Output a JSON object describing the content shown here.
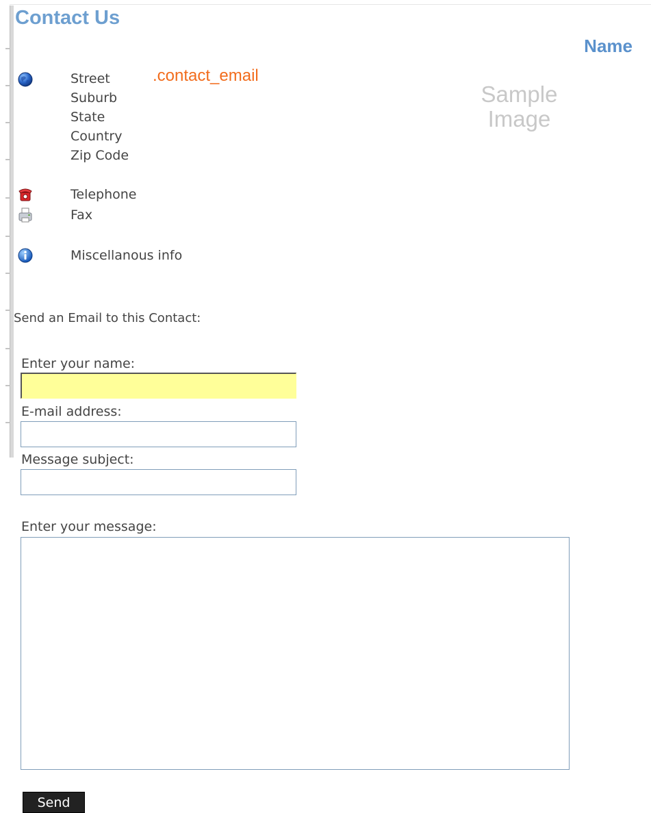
{
  "page": {
    "title": "Contact Us"
  },
  "contact": {
    "name": "Name",
    "email": ".contact_email",
    "image_text_line1": "Sample",
    "image_text_line2": "Image",
    "address": [
      "Street",
      "Suburb",
      "State",
      "Country",
      "Zip Code"
    ],
    "telephone": "Telephone",
    "fax": "Fax",
    "misc": "Miscellanous info"
  },
  "icons": {
    "address": "globe-icon",
    "telephone": "telephone-icon",
    "fax": "fax-icon",
    "misc": "info-icon"
  },
  "form": {
    "heading": "Send an Email to this Contact:",
    "name_label": "Enter your name:",
    "name_value": "",
    "email_label": "E-mail address:",
    "email_value": "",
    "subject_label": "Message subject:",
    "subject_value": "",
    "message_label": "Enter your message:",
    "message_value": "",
    "send_label": "Send"
  },
  "colors": {
    "title": "#6d9fd0",
    "name": "#5a91cc",
    "email": "#f26c1c",
    "focused_field": "#ffff99",
    "button": "#222222"
  }
}
